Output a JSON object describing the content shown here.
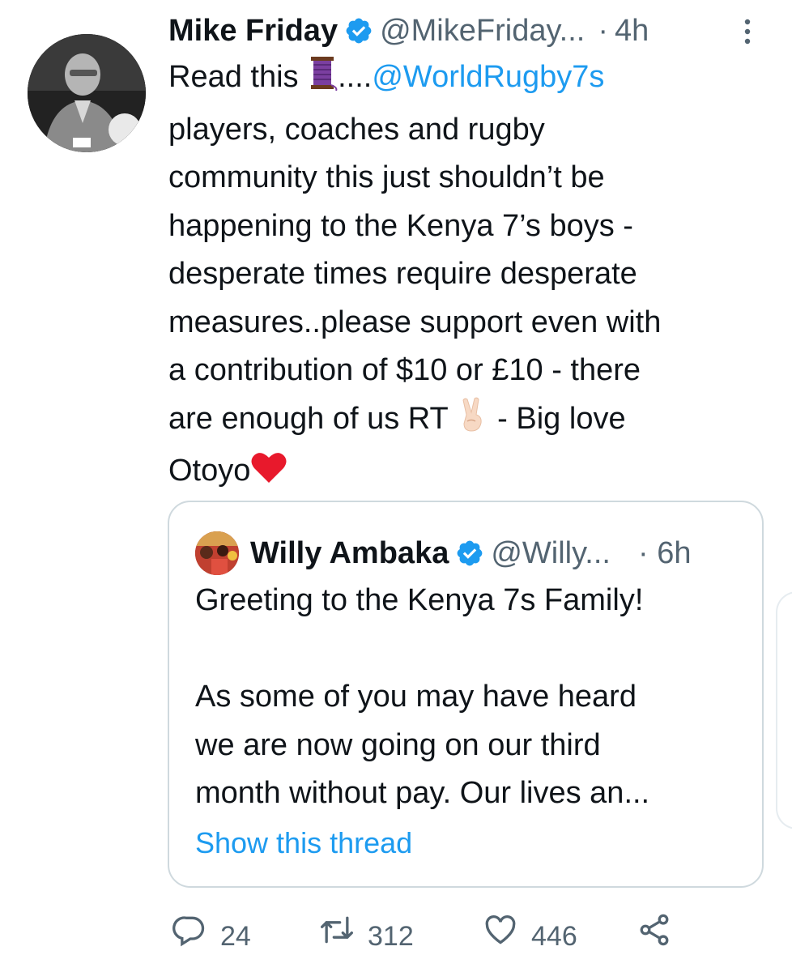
{
  "tweet": {
    "author_name": "Mike Friday",
    "handle": "@MikeFriday...",
    "dot": "·",
    "time": "4h",
    "avatar_icon": "profile-photo",
    "verified_icon": "verified-badge-icon",
    "more_icon": "more-vertical-icon",
    "text": {
      "read_this": "Read this ",
      "dots": "....",
      "mention": "@WorldRugby7s",
      "l2": "players, coaches and rugby",
      "l3": "community this just shouldn’t be",
      "l4": "happening to the Kenya 7’s boys -",
      "l5": "desperate times require desperate",
      "l6": "measures..please support even with",
      "l7": "a contribution of $10 or £10 - there",
      "l8a": "are enough of us RT ",
      "l8b": " - Big love",
      "l9": "Otoyo"
    },
    "emojis": [
      "thread-spool-emoji",
      "victory-hand-emoji",
      "red-heart-emoji"
    ]
  },
  "quoted": {
    "author_name": "Willy Ambaka",
    "handle": "@Willy...",
    "dot": "·",
    "time": "6h",
    "line1": "Greeting to the Kenya 7s Family!",
    "line2": "As some of you may have heard",
    "line3": "we are now going on our third",
    "line4": "month without pay. Our lives an...",
    "show_thread": "Show this thread"
  },
  "actions": {
    "replies": "24",
    "retweets": "312",
    "likes": "446"
  },
  "colors": {
    "link": "#1d9bf0",
    "secondary": "#536471",
    "text": "#0f1419",
    "border": "#cfd9de",
    "heart": "#e0245e",
    "spool": "#7b3fa0"
  }
}
